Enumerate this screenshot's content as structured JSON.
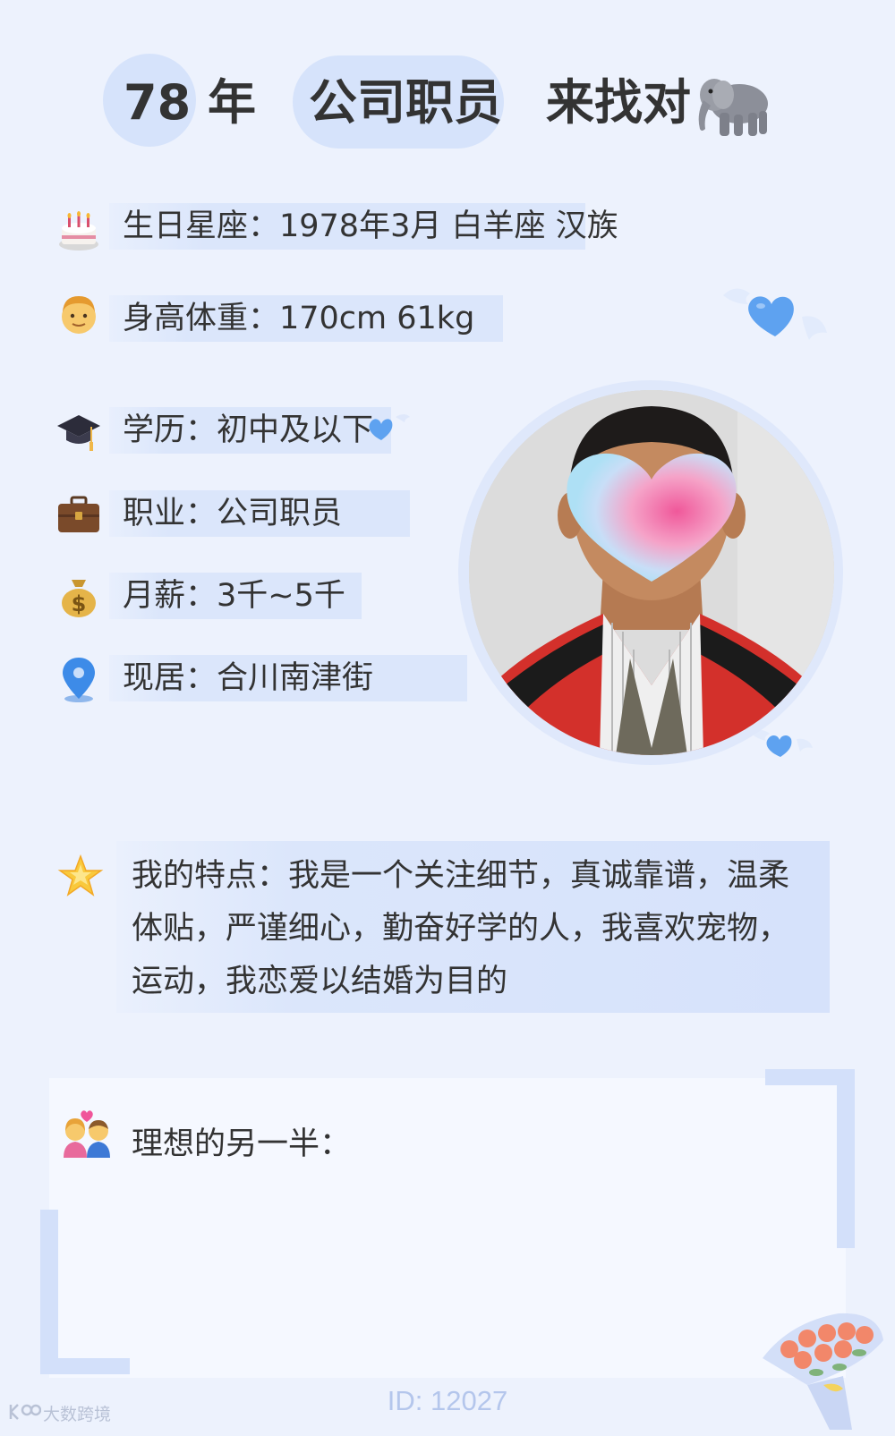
{
  "header": {
    "age": "78",
    "age_unit": "年",
    "occupation": "公司职员",
    "slogan": "来找对",
    "slogan_icon": "elephant-icon"
  },
  "info_rows": [
    {
      "icon": "cake-icon",
      "emoji": "🎂",
      "text": "生日星座：1978年3月 白羊座 汉族"
    },
    {
      "icon": "man-face-icon",
      "emoji": "👨",
      "text": "身高体重：170cm 61kg"
    },
    {
      "icon": "graduation-cap-icon",
      "emoji": "🎓",
      "text": "学历：初中及以下"
    },
    {
      "icon": "briefcase-icon",
      "emoji": "💼",
      "text": "职业：公司职员"
    },
    {
      "icon": "money-bag-icon",
      "emoji": "💰",
      "text": "月薪：3千~5千"
    },
    {
      "icon": "location-pin-icon",
      "emoji": "📍",
      "text": "现居：合川南津街"
    }
  ],
  "features": {
    "icon": "star-icon",
    "text": "我的特点：我是一个关注细节，真诚靠谱，温柔体贴，严谨细心，勤奋好学的人，我喜欢宠物，运动，我恋爱以结婚为目的"
  },
  "ideal": {
    "icon": "couple-icon",
    "label": "理想的另一半："
  },
  "footer": {
    "id_text": "ID: 12027",
    "watermark": "大数跨境"
  },
  "colors": {
    "background": "#edf2fd",
    "pill": "#d6e3fb",
    "band": "#dbe6fb",
    "heart_blue": "#5b9ff0",
    "footer_text": "#b4c6ec"
  }
}
